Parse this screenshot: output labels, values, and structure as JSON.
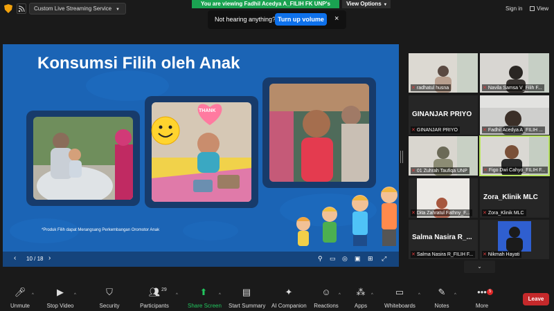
{
  "topbar": {
    "stream_label": "Custom Live Streaming Service",
    "share_banner": "You are viewing Fadhil Acedya A_FILIH FK UNP's screen",
    "view_options": "View Options",
    "sign_in": "Sign in",
    "view": "View"
  },
  "toast": {
    "message": "Not hearing anything?",
    "button": "Turn up volume",
    "close": "×"
  },
  "slide": {
    "title": "Konsumsi Filih oleh Anak",
    "footnote": "*Produk Filih dapat Merangsang Perkembangan Oromotor Anak",
    "page": "10 / 18",
    "thank_sticker": "THANK"
  },
  "participants": [
    {
      "name": "radhatul husna"
    },
    {
      "name": "Navila Samsa V_Filih F..."
    },
    {
      "name": "GINANJAR PRIYO",
      "big": "GINANJAR PRIYO"
    },
    {
      "name": "Fadhil Acedya A_FILIH ..."
    },
    {
      "name": "01 Zuhrah Taufiqa UNP"
    },
    {
      "name": "Figo Dwi Cahyo_FILIH F..."
    },
    {
      "name": "Dita Zahratul Fathny_F..."
    },
    {
      "name": "Zora_Klinik MLC",
      "big": "Zora_Klinik MLC"
    },
    {
      "name": "Salma Nasira R_FILIH F...",
      "big": "Salma  Nasira  R_..."
    },
    {
      "name": "Nikmah Hayati"
    }
  ],
  "toolbar": {
    "unmute": "Unmute",
    "stop_video": "Stop Video",
    "security": "Security",
    "participants": "Participants",
    "participant_count": "29",
    "share_screen": "Share Screen",
    "start_summary": "Start Summary",
    "ai_companion": "AI Companion",
    "reactions": "Reactions",
    "apps": "Apps",
    "whiteboards": "Whiteboards",
    "notes": "Notes",
    "more": "More",
    "more_badge": "5",
    "leave": "Leave"
  },
  "colors": {
    "accent": "#0e71eb",
    "share_green": "#1aa351",
    "leave_red": "#c5292b",
    "slide_bg": "#1b64b5",
    "active_speaker": "#b7e35e"
  }
}
